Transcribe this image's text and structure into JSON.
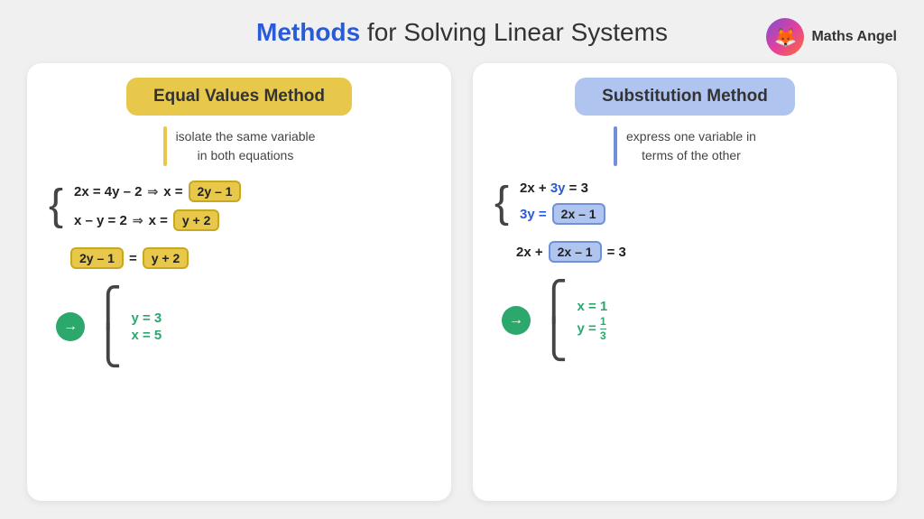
{
  "page": {
    "title_prefix": "Methods",
    "title_suffix": " for Solving Linear Systems"
  },
  "logo": {
    "text": "Maths Angel",
    "emoji": "🦊"
  },
  "left_card": {
    "header": "Equal Values Method",
    "description": "isolate the same variable\nin both equations",
    "eq1_left": "2x = 4y – 2",
    "eq1_arrow": "⇒",
    "eq1_x": "x =",
    "eq1_box": "2y – 1",
    "eq2_left": "x – y = 2",
    "eq2_arrow": "⇒",
    "eq2_x": "x =",
    "eq2_box": "y + 2",
    "combined_left": "2y – 1",
    "combined_eq": "=",
    "combined_right": "y + 2",
    "sol_y": "y = 3",
    "sol_x": "x = 5"
  },
  "right_card": {
    "header": "Substitution Method",
    "description": "express one variable in\nterms of the other",
    "eq1": "2x + 3y = 3",
    "eq2_left": "3y =",
    "eq2_box": "2x – 1",
    "combined_prefix": "2x +",
    "combined_box": "2x – 1",
    "combined_suffix": "= 3",
    "sol_x": "x = 1",
    "sol_y_num": "1",
    "sol_y_den": "3"
  }
}
